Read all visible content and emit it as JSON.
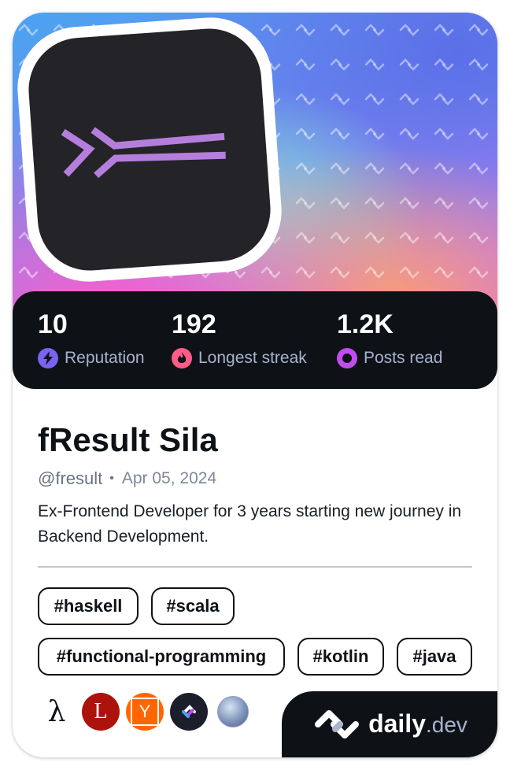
{
  "profile": {
    "name": "fResult Sila",
    "handle": "@fresult",
    "joined": "Apr 05, 2024",
    "bio": "Ex-Frontend Developer for 3 years starting new journey in Backend Development."
  },
  "stats": [
    {
      "value": "10",
      "label": "Reputation",
      "icon": "lightning-icon",
      "color": "#7a63f0"
    },
    {
      "value": "192",
      "label": "Longest streak",
      "icon": "flame-icon",
      "color": "#ff5c8a"
    },
    {
      "value": "1.2K",
      "label": "Posts read",
      "icon": "ring-icon",
      "color": "#c24cf0"
    }
  ],
  "tags": [
    "#haskell",
    "#scala",
    "#functional-programming",
    "#kotlin",
    "#java"
  ],
  "links": [
    {
      "icon": "lambda-icon",
      "glyph": "λ"
    },
    {
      "icon": "lobsters-icon",
      "glyph": "L",
      "color": "#ac130d"
    },
    {
      "icon": "hacker-news-icon",
      "glyph": "Y",
      "color": "#ff6600"
    },
    {
      "icon": "daily-dev-icon"
    },
    {
      "icon": "globe-avatar-icon"
    }
  ],
  "brand": {
    "name": "daily",
    "tld": ".dev"
  },
  "colors": {
    "card_dark": "#0e1217",
    "muted": "#a8b3cf",
    "accent_purple": "#b57edc"
  }
}
